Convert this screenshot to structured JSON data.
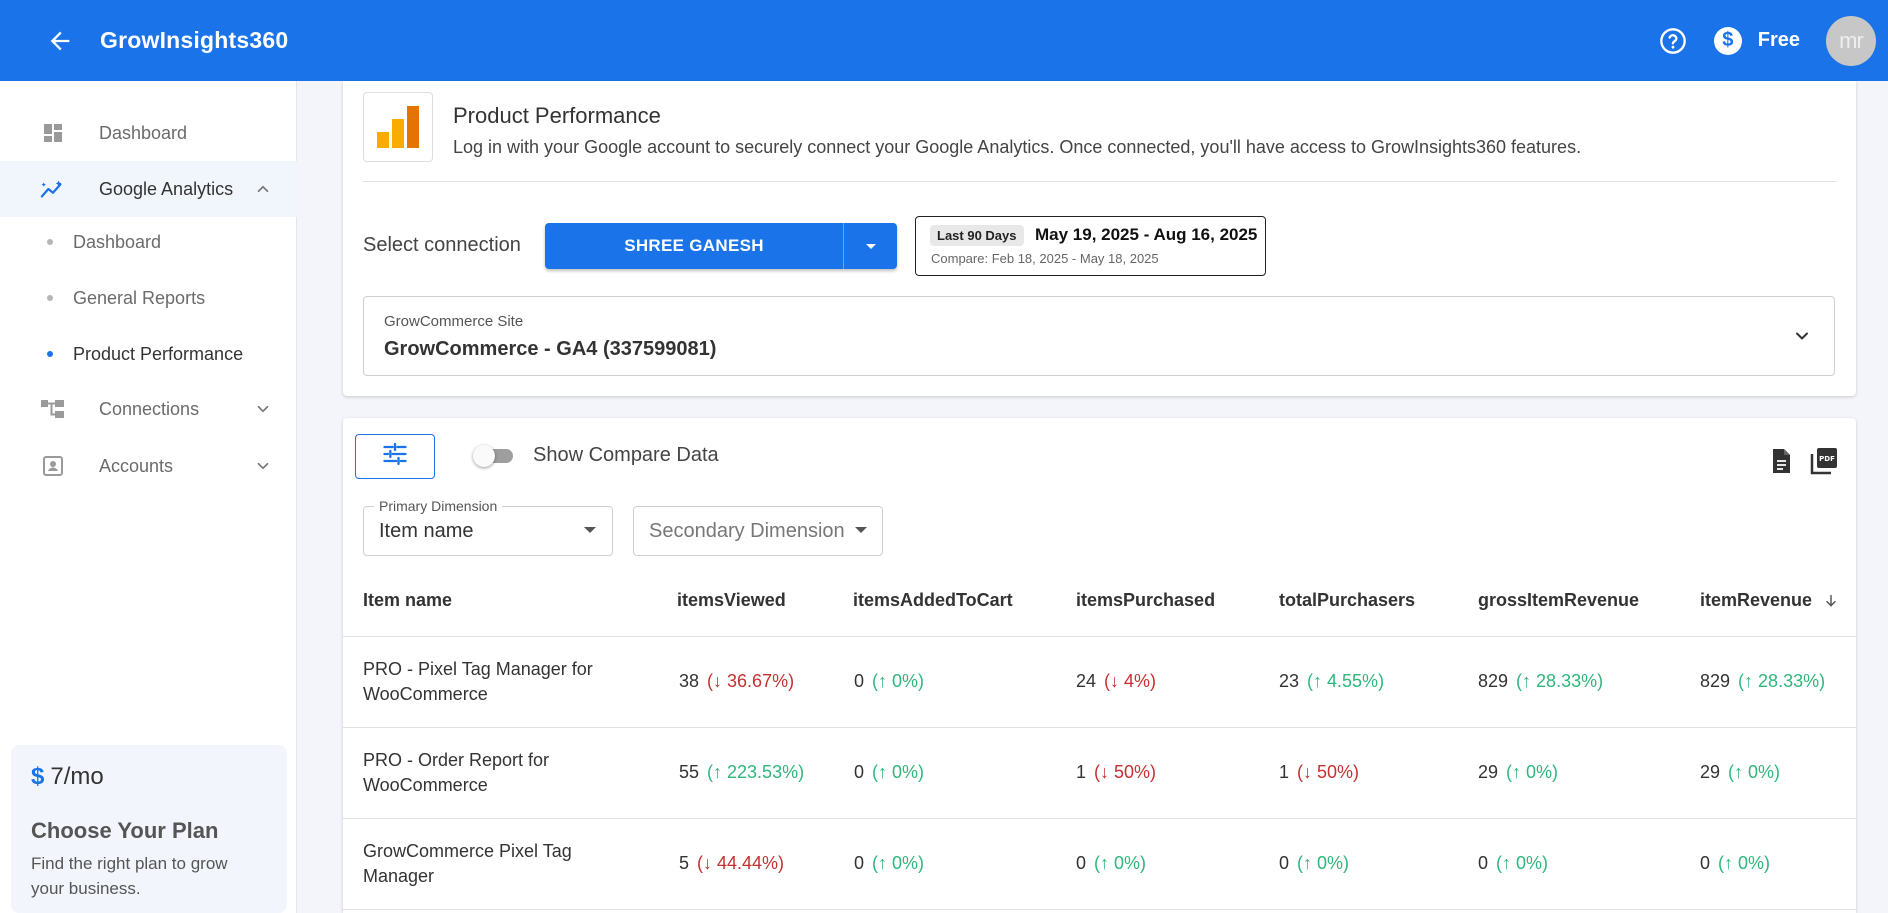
{
  "header": {
    "title": "GrowInsights360",
    "plan_label": "Free",
    "avatar_text": "mr"
  },
  "sidebar": {
    "items": [
      {
        "label": "Dashboard"
      },
      {
        "label": "Google Analytics"
      },
      {
        "label": "Connections"
      },
      {
        "label": "Accounts"
      }
    ],
    "ga_subitems": [
      {
        "label": "Dashboard"
      },
      {
        "label": "General Reports"
      },
      {
        "label": "Product Performance"
      }
    ],
    "plan_card": {
      "price": "7/mo",
      "currency": "$",
      "title": "Choose Your Plan",
      "subtitle": "Find the right plan to grow your business."
    }
  },
  "product_performance": {
    "title": "Product Performance",
    "description": "Log in with your Google account to securely connect your Google Analytics. Once connected, you'll have access to GrowInsights360 features."
  },
  "connection": {
    "label": "Select connection",
    "selected": "SHREE GANESH"
  },
  "date_range": {
    "preset": "Last 90 Days",
    "range": "May 19, 2025 - Aug 16, 2025",
    "compare": "Compare: Feb 18, 2025 - May 18, 2025"
  },
  "site": {
    "label": "GrowCommerce Site",
    "value": "GrowCommerce - GA4 (337599081)"
  },
  "controls": {
    "compare_toggle_label": "Show Compare Data",
    "compare_enabled": false,
    "primary_dimension_label": "Primary Dimension",
    "primary_dimension_value": "Item name",
    "secondary_dimension_placeholder": "Secondary Dimension"
  },
  "table": {
    "columns": [
      "Item name",
      "itemsViewed",
      "itemsAddedToCart",
      "itemsPurchased",
      "totalPurchasers",
      "grossItemRevenue",
      "itemRevenue"
    ],
    "rows": [
      {
        "name": "PRO - Pixel Tag Manager for WooCommerce",
        "values": [
          {
            "v": "38",
            "c": "(↓ 36.67%)",
            "dir": "down"
          },
          {
            "v": "0",
            "c": "(↑ 0%)",
            "dir": "up"
          },
          {
            "v": "24",
            "c": "(↓ 4%)",
            "dir": "down"
          },
          {
            "v": "23",
            "c": "(↑ 4.55%)",
            "dir": "up"
          },
          {
            "v": "829",
            "c": "(↑ 28.33%)",
            "dir": "up"
          },
          {
            "v": "829",
            "c": "(↑ 28.33%)",
            "dir": "up"
          }
        ]
      },
      {
        "name": "PRO - Order Report for WooCommerce",
        "values": [
          {
            "v": "55",
            "c": "(↑ 223.53%)",
            "dir": "up"
          },
          {
            "v": "0",
            "c": "(↑ 0%)",
            "dir": "up"
          },
          {
            "v": "1",
            "c": "(↓ 50%)",
            "dir": "down"
          },
          {
            "v": "1",
            "c": "(↓ 50%)",
            "dir": "down"
          },
          {
            "v": "29",
            "c": "(↑ 0%)",
            "dir": "up"
          },
          {
            "v": "29",
            "c": "(↑ 0%)",
            "dir": "up"
          }
        ]
      },
      {
        "name": "GrowCommerce Pixel Tag Manager",
        "values": [
          {
            "v": "5",
            "c": "(↓ 44.44%)",
            "dir": "down"
          },
          {
            "v": "0",
            "c": "(↑ 0%)",
            "dir": "up"
          },
          {
            "v": "0",
            "c": "(↑ 0%)",
            "dir": "up"
          },
          {
            "v": "0",
            "c": "(↑ 0%)",
            "dir": "up"
          },
          {
            "v": "0",
            "c": "(↑ 0%)",
            "dir": "up"
          },
          {
            "v": "0",
            "c": "(↑ 0%)",
            "dir": "up"
          }
        ]
      }
    ]
  },
  "colors": {
    "brand": "#1a73e8",
    "positive": "#2fb67c",
    "negative": "#c53030"
  }
}
